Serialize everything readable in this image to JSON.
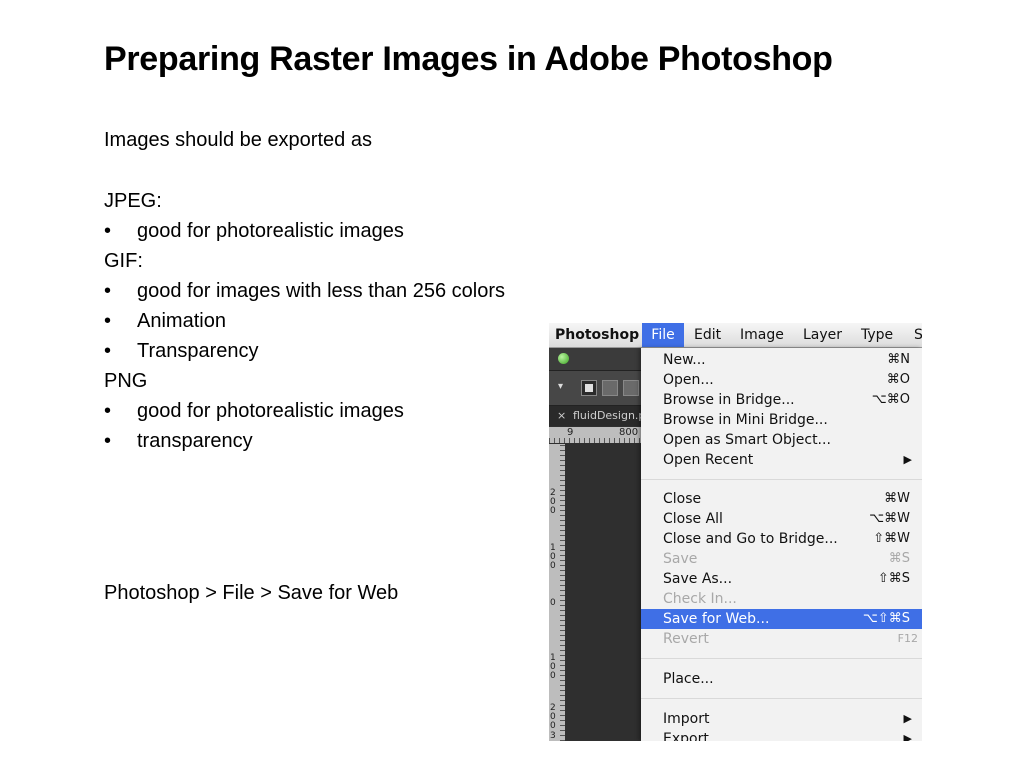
{
  "slide": {
    "title": "Preparing Raster Images in Adobe Photoshop",
    "intro": "Images should be exported as",
    "jpeg_heading": "JPEG:",
    "jpeg_bullets": [
      "good for photorealistic images"
    ],
    "gif_heading": "GIF:",
    "gif_bullets": [
      "good for images with less than 256 colors",
      "Animation",
      "Transparency"
    ],
    "png_heading": "PNG",
    "png_bullets": [
      "good for photorealistic images",
      "transparency"
    ],
    "path_text": "Photoshop > File > Save for Web"
  },
  "screenshot": {
    "menubar": {
      "app": "Photoshop",
      "items": [
        "File",
        "Edit",
        "Image",
        "Layer",
        "Type",
        "S"
      ],
      "active": "File"
    },
    "workspace": {
      "tab_close": "×",
      "tab_label": "fluidDesign.p",
      "ruler_h": [
        "9",
        "800"
      ],
      "ruler_v": [
        "200",
        "100",
        "0",
        "100",
        "200",
        "3"
      ]
    },
    "file_menu": [
      {
        "label": "New...",
        "shortcut": "⌘N"
      },
      {
        "label": "Open...",
        "shortcut": "⌘O"
      },
      {
        "label": "Browse in Bridge...",
        "shortcut": "⌥⌘O"
      },
      {
        "label": "Browse in Mini Bridge...",
        "shortcut": ""
      },
      {
        "label": "Open as Smart Object...",
        "shortcut": ""
      },
      {
        "label": "Open Recent",
        "shortcut": "▶"
      },
      {
        "label": "Close",
        "shortcut": "⌘W"
      },
      {
        "label": "Close All",
        "shortcut": "⌥⌘W"
      },
      {
        "label": "Close and Go to Bridge...",
        "shortcut": "⇧⌘W"
      },
      {
        "label": "Save",
        "shortcut": "⌘S"
      },
      {
        "label": "Save As...",
        "shortcut": "⇧⌘S"
      },
      {
        "label": "Check In...",
        "shortcut": ""
      },
      {
        "label": "Save for Web...",
        "shortcut": "⌥⇧⌘S"
      },
      {
        "label": "Revert",
        "shortcut": "F12"
      },
      {
        "label": "Place...",
        "shortcut": ""
      },
      {
        "label": "Import",
        "shortcut": "▶"
      },
      {
        "label": "Export",
        "shortcut": "▶"
      }
    ],
    "highlight_color": "#3f6fe6"
  }
}
